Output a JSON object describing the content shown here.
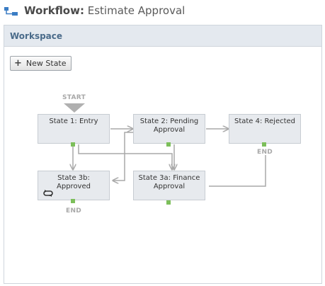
{
  "header": {
    "title_prefix": "Workflow:",
    "title_name": "Estimate Approval"
  },
  "panel": {
    "title": "Workspace",
    "new_state_label": "New State"
  },
  "markers": {
    "start": "START",
    "end_rejected": "END",
    "end_approved": "END"
  },
  "states": {
    "entry": "State 1: Entry",
    "pending": "State 2: Pending Approval",
    "rejected": "State 4: Rejected",
    "approved": "State 3b: Approved",
    "finance": "State 3a: Finance Approval"
  },
  "colors": {
    "panel_header": "#e4e9ef",
    "panel_title": "#4a6b8a",
    "state_fill": "#e7eaee",
    "edge": "#a9a9a9",
    "handle": "#7cbf5a"
  }
}
